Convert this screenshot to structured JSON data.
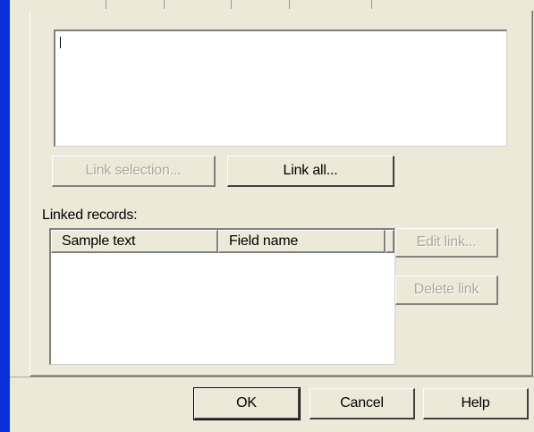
{
  "editor": {
    "text_value": ""
  },
  "buttons": {
    "link_selection": "Link selection...",
    "link_all": "Link all...",
    "edit_link": "Edit link...",
    "delete_link": "Delete link",
    "ok": "OK",
    "cancel": "Cancel",
    "help": "Help"
  },
  "linked_records": {
    "label": "Linked records:",
    "columns": [
      "Sample text",
      "Field name"
    ],
    "rows": []
  },
  "colors": {
    "dialog_bg": "#ECE9D8",
    "window_edge": "#0831D9",
    "disabled_text": "#ACA899"
  }
}
